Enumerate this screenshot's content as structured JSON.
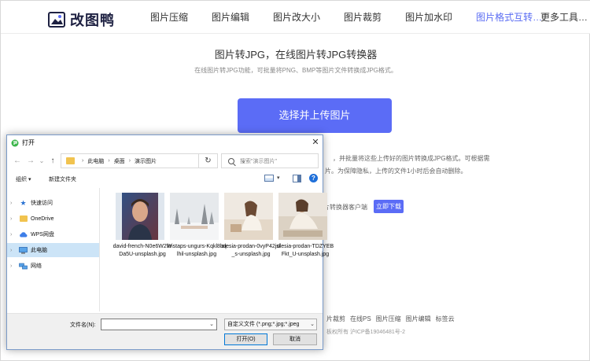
{
  "site": {
    "logo_text": "改图鸭",
    "nav": [
      {
        "label": "图片压缩"
      },
      {
        "label": "图片编辑"
      },
      {
        "label": "图片改大小"
      },
      {
        "label": "图片裁剪"
      },
      {
        "label": "图片加水印"
      },
      {
        "label": "图片格式互转…"
      }
    ],
    "nav_more": "更多工具…",
    "hero_title": "图片转JPG，在线图片转JPG转换器",
    "hero_subtitle": "在线图片转JPG功能，可批量将PNG、BMP等图片文件转换成JPG格式。",
    "upload_button": "选择并上传图片",
    "desc_line1": "，并批量将这些上传好的图片转换成JPG格式。可根据需",
    "desc_line2": "片。为保障隐私，上传的文件1小时后会自动删除。",
    "download_hint": "片转换器客户端",
    "download_button": "立即下载",
    "footer_links": [
      "片裁剪",
      "在线PS",
      "图片压缩",
      "图片编辑",
      "标签云"
    ],
    "footer_copy": "板权所有 沪ICP备19046481号-2",
    "colors": {
      "accent": "#5b6cf6",
      "nav_active": "#5a6cf3"
    }
  },
  "dialog": {
    "title": "打开",
    "close_glyph": "✕",
    "back_glyph": "←",
    "forward_glyph": "→",
    "recent_glyph": "⌄",
    "up_glyph": "↑",
    "breadcrumb": [
      "此电脑",
      "桌面",
      "演示图片"
    ],
    "breadcrumb_sep": "›",
    "refresh_glyph": "↻",
    "search_placeholder": "搜索\"演示图片\"",
    "toolbar": {
      "organize": "组织 ▾",
      "new_folder": "新建文件夹",
      "help": "?"
    },
    "tree": [
      {
        "label": "快速访问",
        "icon": "star-icon"
      },
      {
        "label": "OneDrive",
        "icon": "folder-icon"
      },
      {
        "label": "WPS网盘",
        "icon": "cloud-icon"
      },
      {
        "label": "此电脑",
        "icon": "computer-icon"
      },
      {
        "label": "网络",
        "icon": "network-icon"
      }
    ],
    "files": [
      {
        "name": "david-french-N0e6W2WDa5U-unsplash.jpg"
      },
      {
        "name": "kristaps-ungurs-Kqkl8bqlhil-unsplash.jpg"
      },
      {
        "name": "olesia-prodan-0vyP42jsl_s-unsplash.jpg"
      },
      {
        "name": "olesia-prodan-TDZYEBFkt_U-unsplash.jpg"
      }
    ],
    "filename_label": "文件名(N):",
    "filename_value": "",
    "filter": "自定义文件 (*.png;*.jpg;*.jpeg",
    "open_button": "打开(O)",
    "cancel_button": "取消"
  }
}
